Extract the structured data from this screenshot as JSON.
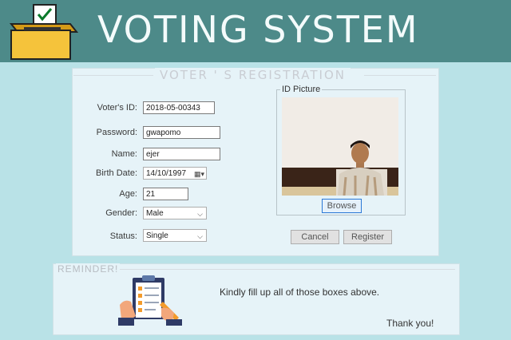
{
  "app": {
    "title": "VOTING SYSTEM"
  },
  "registration": {
    "legend": "VOTER ' S REGISTRATION",
    "fields": {
      "voter_id": {
        "label": "Voter's ID:",
        "value": "2018-05-00343"
      },
      "password": {
        "label": "Password:",
        "value": "gwapomo"
      },
      "name": {
        "label": "Name:",
        "value": "ejer"
      },
      "birth_date": {
        "label": "Birth Date:",
        "value": "14/10/1997"
      },
      "age": {
        "label": "Age:",
        "value": "21"
      },
      "gender": {
        "label": "Gender:",
        "value": "Male"
      },
      "status": {
        "label": "Status:",
        "value": "Single"
      }
    },
    "id_picture": {
      "legend": "ID Picture",
      "browse_label": "Browse"
    },
    "cancel_label": "Cancel",
    "register_label": "Register"
  },
  "reminder": {
    "legend": "REMINDER!",
    "message": "Kindly fill up all of those boxes above.",
    "thanks": "Thank you!"
  },
  "icons": {
    "logo": "ballot-box-check-icon",
    "calendar": "calendar-icon",
    "dropdown": "chevron-down-icon",
    "reminder": "clipboard-checklist-icon"
  },
  "colors": {
    "header_bg": "#4d8a89",
    "page_bg": "#b9e2e7",
    "panel_bg": "#e6f3f8",
    "ballot_yellow": "#f5c33b"
  }
}
